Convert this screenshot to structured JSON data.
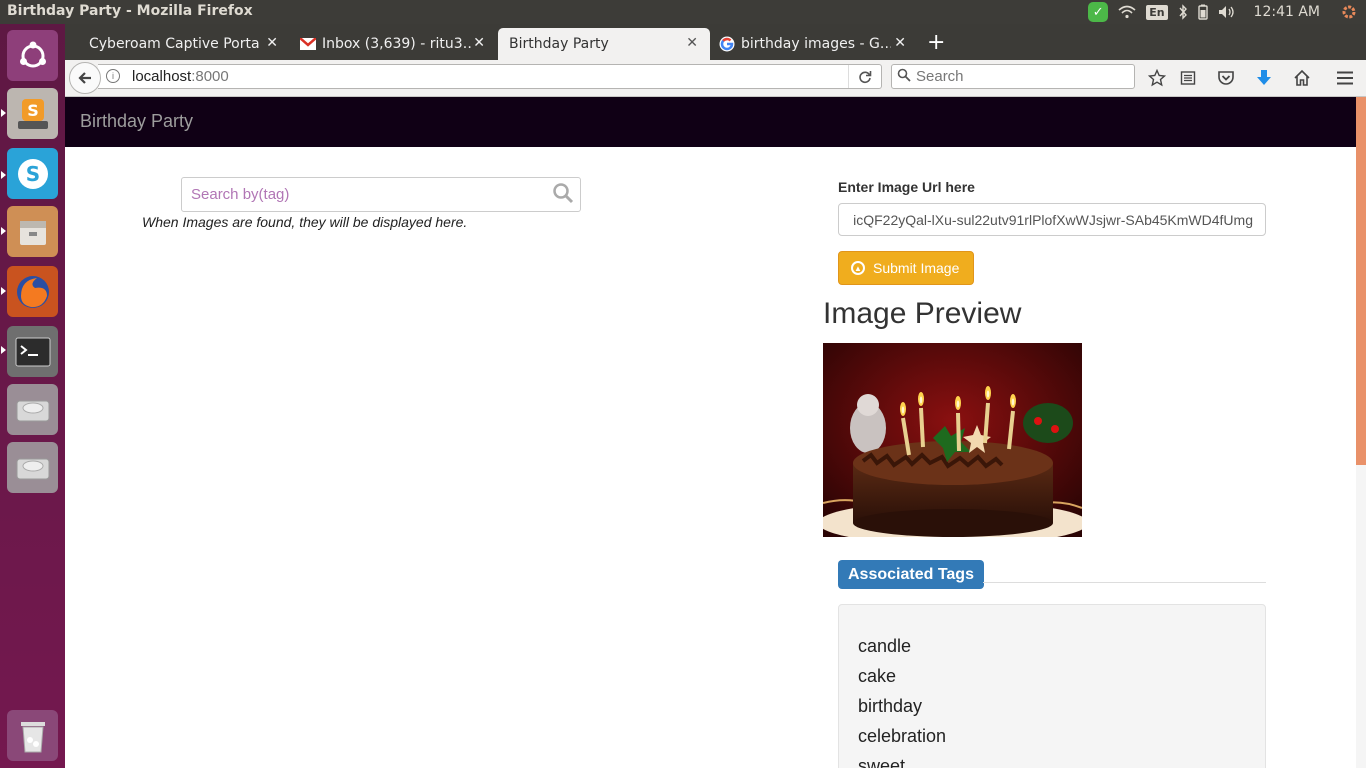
{
  "os": {
    "window_title": "Birthday Party - Mozilla Firefox",
    "keyboard_layout": "En",
    "clock": "12:41 AM"
  },
  "browser": {
    "tabs": [
      {
        "label": "Cyberoam Captive Portal",
        "active": false
      },
      {
        "label": "Inbox (3,639) - ritu3…",
        "active": false,
        "favicon": "gmail-icon"
      },
      {
        "label": "Birthday Party",
        "active": true
      },
      {
        "label": "birthday images - G…",
        "active": false,
        "favicon": "google-icon"
      }
    ],
    "url_host": "localhost",
    "url_port": ":8000",
    "search_placeholder": "Search"
  },
  "app": {
    "brand": "Birthday Party",
    "search_placeholder": "Search by(tag)",
    "help_text": "When Images are found, they will be displayed here.",
    "url_label": "Enter Image Url here",
    "url_value": "icQF22yQal-lXu-sul22utv91rlPlofXwWJsjwr-SAb45KmWD4fUmg",
    "submit_label": "Submit Image",
    "preview_heading": "Image Preview",
    "tags_heading": "Associated Tags",
    "tags": [
      "candle",
      "cake",
      "birthday",
      "celebration",
      "sweet"
    ]
  },
  "colors": {
    "navbar_bg": "#100015",
    "submit_bg": "#f0ad1e",
    "badge_bg": "#337ab7",
    "launcher_bg": "#74184f"
  }
}
